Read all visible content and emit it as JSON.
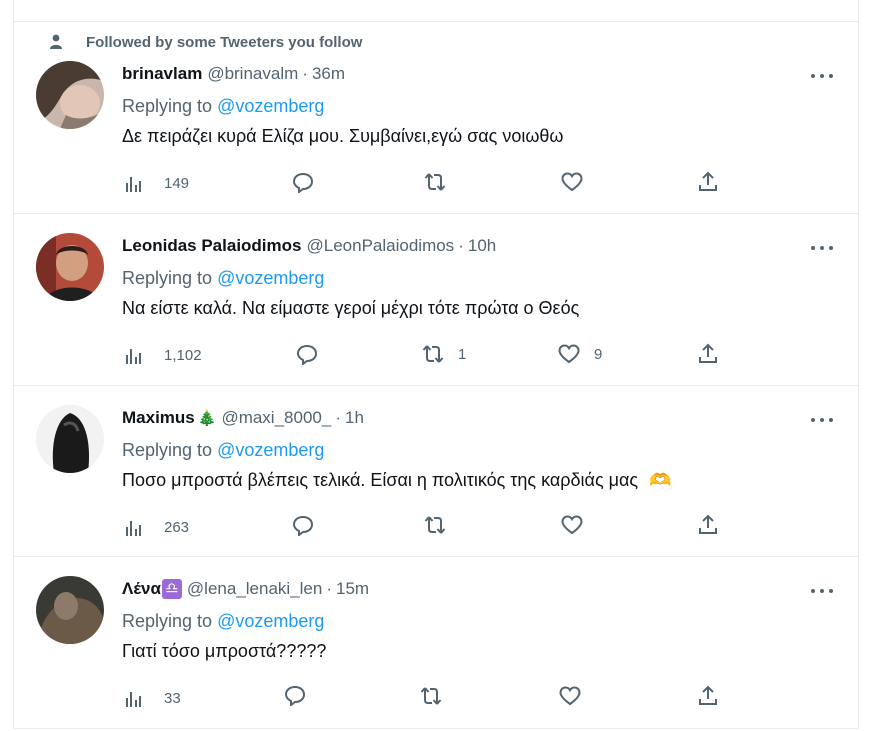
{
  "social_context": "Followed by some Tweeters you follow",
  "tweets": [
    {
      "display_name": "brinavlam",
      "handle": "@brinavalm",
      "dot": "·",
      "time": "36m",
      "replying_prefix": "Replying to ",
      "replying_to": "@vozemberg",
      "text": "Δε πειράζει κυρά Ελίζα μου. Συμβαίνει,εγώ σας νοιωθω",
      "views": "149",
      "replies": "",
      "retweets": "",
      "likes": ""
    },
    {
      "display_name": "Leonidas Palaiodimos",
      "handle": "@LeonPalaiodimos",
      "dot": "·",
      "time": "10h",
      "replying_prefix": "Replying to ",
      "replying_to": "@vozemberg",
      "text": "Να είστε καλά. Να είμαστε γεροί μέχρι τότε πρώτα ο Θεός",
      "views": "1,102",
      "replies": "",
      "retweets": "1",
      "likes": "9"
    },
    {
      "display_name": "Maximus",
      "name_emoji": "🎄",
      "handle": "@maxi_8000_",
      "dot": "·",
      "time": "1h",
      "replying_prefix": "Replying to ",
      "replying_to": "@vozemberg",
      "text": "Ποσο μπροστά βλέπεις τελικά. Είσαι η πολιτικός της καρδιάς μας",
      "text_emoji": "🫶",
      "views": "263",
      "replies": "",
      "retweets": "",
      "likes": ""
    },
    {
      "display_name": "Λένα",
      "name_emoji": "♎",
      "handle": "@lena_lenaki_len",
      "dot": "·",
      "time": "15m",
      "replying_prefix": "Replying to ",
      "replying_to": "@vozemberg",
      "text": "Γιατί τόσο μπροστά?????",
      "views": "33",
      "replies": "",
      "retweets": "",
      "likes": ""
    }
  ],
  "icons": {
    "person": "person-icon",
    "views": "bar-chart-icon",
    "reply": "speech-bubble-icon",
    "retweet": "retweet-icon",
    "like": "heart-icon",
    "share": "share-icon",
    "more": "more-dots-icon"
  },
  "colors": {
    "accent": "#1d9bf0",
    "secondary_text": "#536471",
    "primary_text": "#0f1419",
    "border": "#e6ecf0"
  }
}
